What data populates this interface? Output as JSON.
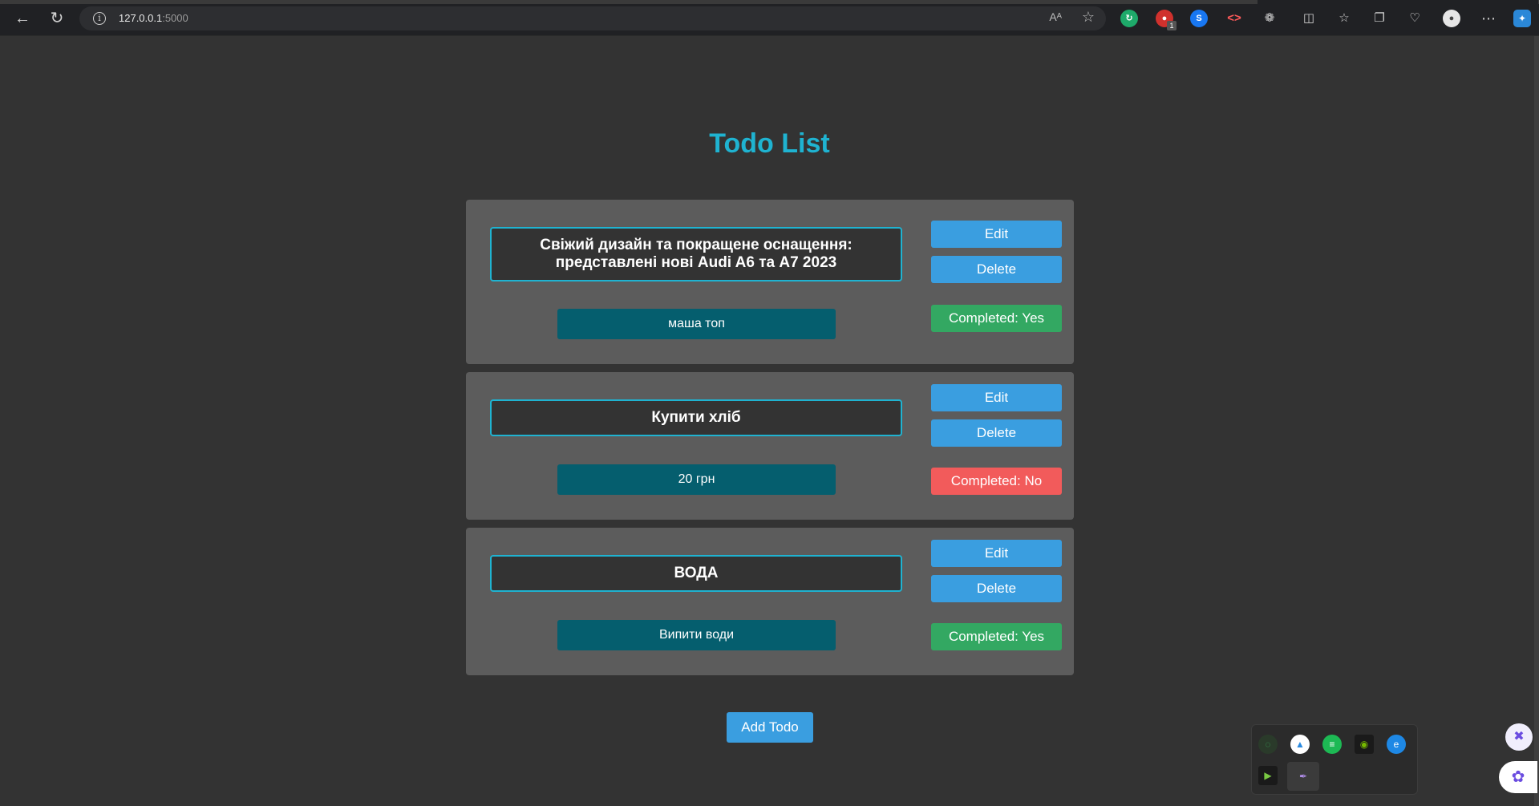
{
  "browser": {
    "url_host": "127.0.0.1",
    "url_port": ":5000",
    "read_aloud_icon": "Aᴬ",
    "toolbar_badge": "1"
  },
  "page": {
    "title": "Todo List",
    "add_label": "Add Todo"
  },
  "todos": [
    {
      "title": "Свіжий дизайн та покращене оснащення: представлені нові Audi A6 та A7 2023",
      "description": "маша топ",
      "edit_label": "Edit",
      "delete_label": "Delete",
      "status_label": "Completed: Yes",
      "completed": true
    },
    {
      "title": "Купити хліб",
      "description": "20 грн",
      "edit_label": "Edit",
      "delete_label": "Delete",
      "status_label": "Completed: No",
      "completed": false
    },
    {
      "title": "ВОДА",
      "description": "Випити води",
      "edit_label": "Edit",
      "delete_label": "Delete",
      "status_label": "Completed: Yes",
      "completed": true
    }
  ],
  "colors": {
    "accent": "#1fb3d1",
    "button_blue": "#3a9ee0",
    "completed_yes": "#33a862",
    "completed_no": "#f25b5b",
    "description_bg": "#055e6e"
  }
}
